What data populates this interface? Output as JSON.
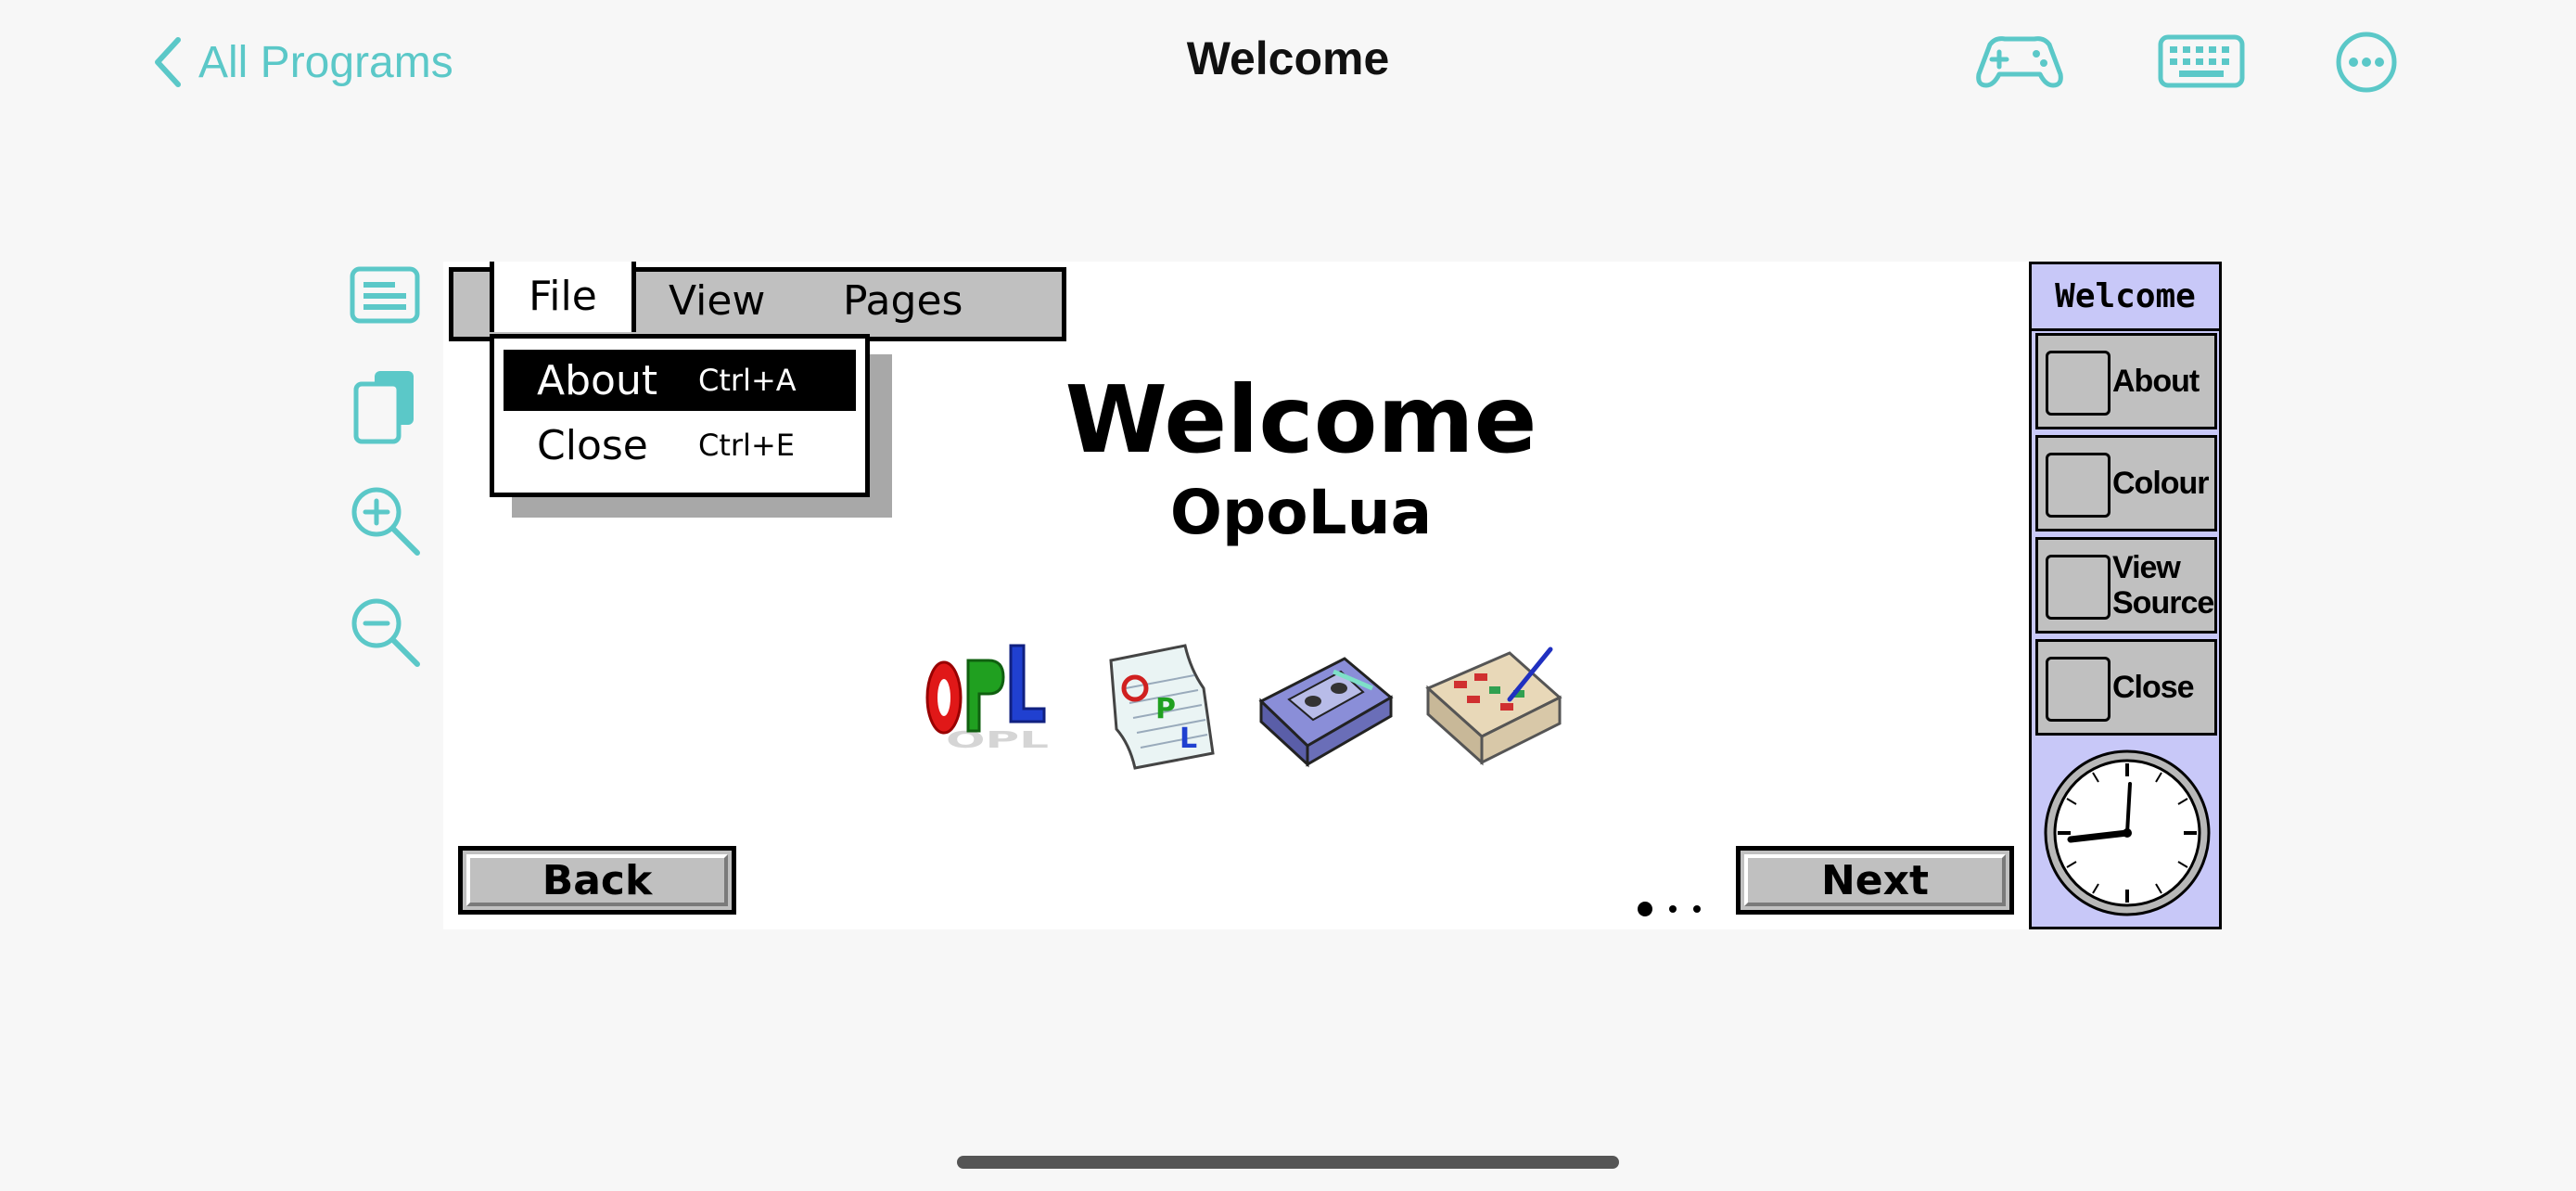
{
  "nav": {
    "back_label": "All Programs",
    "title": "Welcome",
    "icons": [
      "game-controller-icon",
      "keyboard-icon",
      "more-icon"
    ]
  },
  "side_toolbar": [
    "menu-icon",
    "copy-icon",
    "zoom-in-icon",
    "zoom-out-icon"
  ],
  "menubar": {
    "items": [
      "File",
      "View",
      "Pages"
    ],
    "dropdown": [
      {
        "label": "About",
        "shortcut": "Ctrl+A",
        "selected": true
      },
      {
        "label": "Close",
        "shortcut": "Ctrl+E",
        "selected": false
      }
    ]
  },
  "content": {
    "title": "Welcome",
    "subtitle": "OpoLua",
    "icons": [
      "opl-logo-icon",
      "opl-document-icon",
      "cassette-icon",
      "calendar-icon"
    ]
  },
  "buttons": {
    "back": "Back",
    "next": "Next"
  },
  "page_dots": {
    "count": 3,
    "active": 1
  },
  "toolbar": {
    "title": "Welcome",
    "buttons": [
      "About",
      "Colour",
      "View\nSource",
      "Close"
    ]
  },
  "colors": {
    "accent": "#5bc8c8",
    "toolbar_bg": "#c8c8f8",
    "button_grey": "#c0c0c0"
  }
}
